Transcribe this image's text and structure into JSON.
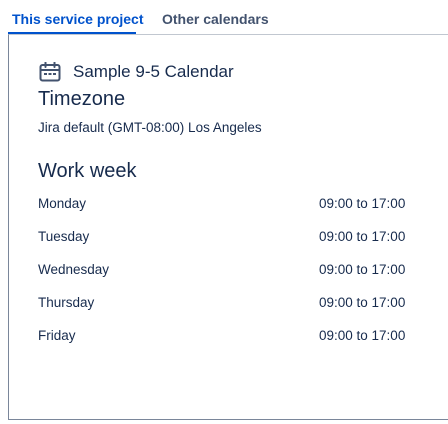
{
  "tabs": [
    {
      "label": "This service project",
      "active": true
    },
    {
      "label": "Other calendars",
      "active": false
    }
  ],
  "colors": {
    "accent": "#0052cc",
    "text": "#172b4d",
    "border": "#7a869a"
  },
  "calendar": {
    "icon": "calendar-icon",
    "name": "Sample 9-5 Calendar"
  },
  "timezone": {
    "title": "Timezone",
    "value": "Jira default (GMT-08:00) Los Angeles"
  },
  "work_week": {
    "title": "Work week",
    "days": [
      {
        "day": "Monday",
        "hours": "09:00 to 17:00"
      },
      {
        "day": "Tuesday",
        "hours": "09:00 to 17:00"
      },
      {
        "day": "Wednesday",
        "hours": "09:00 to 17:00"
      },
      {
        "day": "Thursday",
        "hours": "09:00 to 17:00"
      },
      {
        "day": "Friday",
        "hours": "09:00 to 17:00"
      }
    ]
  }
}
